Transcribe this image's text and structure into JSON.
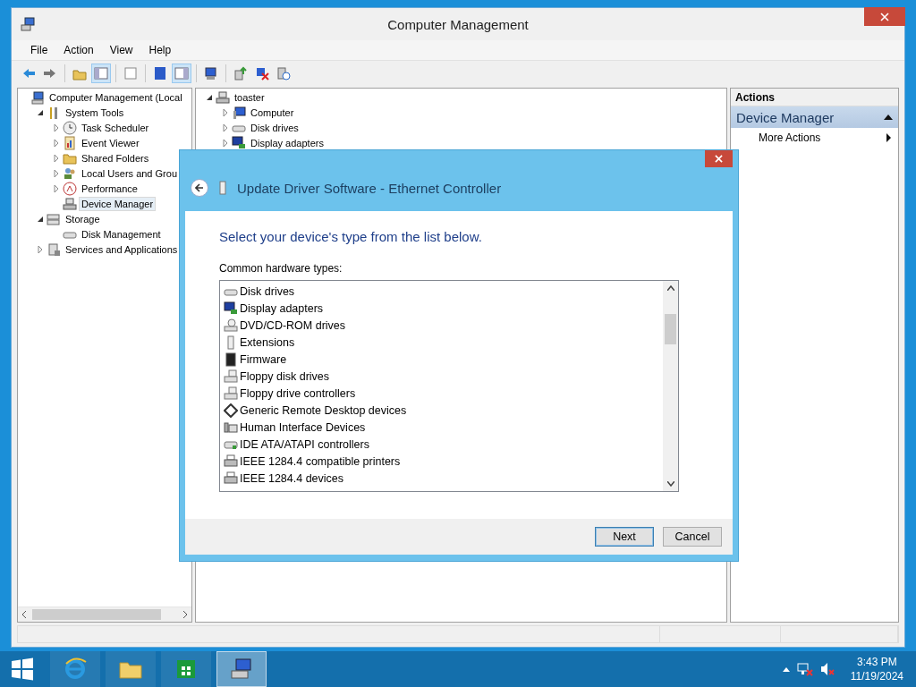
{
  "window": {
    "title": "Computer Management"
  },
  "menu": [
    "File",
    "Action",
    "View",
    "Help"
  ],
  "toolbar": [
    {
      "kind": "back",
      "pressed": false
    },
    {
      "kind": "forward",
      "pressed": false
    },
    {
      "kind": "sep"
    },
    {
      "kind": "up",
      "pressed": false
    },
    {
      "kind": "tree",
      "pressed": true
    },
    {
      "kind": "sep"
    },
    {
      "kind": "properties",
      "pressed": false
    },
    {
      "kind": "sep"
    },
    {
      "kind": "help",
      "pressed": false
    },
    {
      "kind": "pane",
      "pressed": true
    },
    {
      "kind": "sep"
    },
    {
      "kind": "scan",
      "pressed": false
    },
    {
      "kind": "sep"
    },
    {
      "kind": "update",
      "pressed": false
    },
    {
      "kind": "uninstall",
      "pressed": false
    },
    {
      "kind": "add",
      "pressed": false
    }
  ],
  "console_tree": [
    {
      "label": "Computer Management (Local",
      "kind": "computer",
      "selected": false,
      "children": [
        {
          "label": "System Tools",
          "kind": "tools",
          "expanded": true,
          "selected": false,
          "children": [
            {
              "label": "Task Scheduler",
              "kind": "clock",
              "expanded": false,
              "selected": false
            },
            {
              "label": "Event Viewer",
              "kind": "log",
              "expanded": false,
              "selected": false
            },
            {
              "label": "Shared Folders",
              "kind": "folder",
              "expanded": false,
              "selected": false
            },
            {
              "label": "Local Users and Grou",
              "kind": "users",
              "expanded": false,
              "selected": false
            },
            {
              "label": "Performance",
              "kind": "performance",
              "expanded": false,
              "selected": false
            },
            {
              "label": "Device Manager",
              "kind": "devices",
              "selected": true
            }
          ]
        },
        {
          "label": "Storage",
          "kind": "storage",
          "expanded": true,
          "selected": false,
          "children": [
            {
              "label": "Disk Management",
              "kind": "disk",
              "selected": false
            }
          ]
        },
        {
          "label": "Services and Applications",
          "kind": "services",
          "expanded": false,
          "selected": false
        }
      ]
    }
  ],
  "device_tree": [
    {
      "label": "toaster",
      "kind": "devices",
      "expanded": true,
      "children": [
        {
          "label": "Computer",
          "kind": "monitor",
          "expanded": false
        },
        {
          "label": "Disk drives",
          "kind": "disk",
          "expanded": false
        },
        {
          "label": "Display adapters",
          "kind": "display",
          "expanded": false
        }
      ]
    }
  ],
  "actions": {
    "header": "Actions",
    "section": {
      "title": "Device Manager",
      "expanded": true
    },
    "items": [
      "More Actions"
    ]
  },
  "dialog": {
    "title": "Update Driver Software - Ethernet Controller",
    "heading": "Select your device's type from the list below.",
    "list_label": "Common hardware types:",
    "items": [
      {
        "label": "Disk drives",
        "kind": "disk",
        "selected": false
      },
      {
        "label": "Display adapters",
        "kind": "display",
        "selected": false
      },
      {
        "label": "DVD/CD-ROM drives",
        "kind": "dvd",
        "selected": false
      },
      {
        "label": "Extensions",
        "kind": "extension",
        "selected": false
      },
      {
        "label": "Firmware",
        "kind": "firmware",
        "selected": false
      },
      {
        "label": "Floppy disk drives",
        "kind": "floppy",
        "selected": false
      },
      {
        "label": "Floppy drive controllers",
        "kind": "floppy",
        "selected": false
      },
      {
        "label": "Generic Remote Desktop devices",
        "kind": "remote",
        "selected": false
      },
      {
        "label": "Human Interface Devices",
        "kind": "hid",
        "selected": false
      },
      {
        "label": "IDE ATA/ATAPI controllers",
        "kind": "ide",
        "selected": false
      },
      {
        "label": "IEEE 1284.4 compatible printers",
        "kind": "printer",
        "selected": false
      },
      {
        "label": "IEEE 1284.4 devices",
        "kind": "printer",
        "selected": false
      }
    ],
    "buttons": [
      {
        "label": "Next",
        "default": true
      },
      {
        "label": "Cancel",
        "default": false
      }
    ]
  },
  "taskbar": {
    "apps": [
      {
        "kind": "ie",
        "active": false
      },
      {
        "kind": "explorer",
        "active": false
      },
      {
        "kind": "store",
        "active": false
      },
      {
        "kind": "management",
        "active": true
      }
    ],
    "time": "3:43 PM",
    "date": "11/19/2024"
  }
}
